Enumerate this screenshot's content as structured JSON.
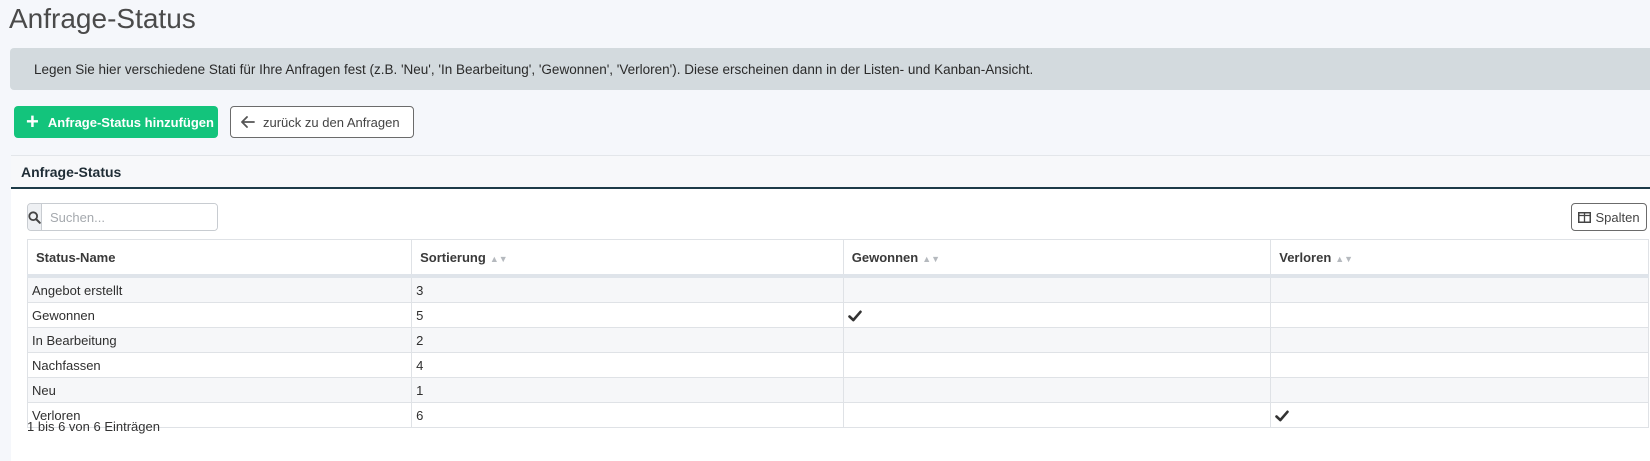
{
  "page": {
    "title": "Anfrage-Status"
  },
  "banner": {
    "text": "Legen Sie hier verschiedene Stati für Ihre Anfragen fest (z.B. 'Neu', 'In Bearbeitung', 'Gewonnen', 'Verloren'). Diese erscheinen dann in der Listen- und Kanban-Ansicht."
  },
  "actions": {
    "add_label": "Anfrage-Status hinzufügen",
    "back_label": "zurück zu den Anfragen"
  },
  "card": {
    "title": "Anfrage-Status",
    "search_placeholder": "Suchen...",
    "columns_button": "Spalten"
  },
  "table": {
    "headers": [
      "Status-Name",
      "Sortierung",
      "Gewonnen",
      "Verloren"
    ],
    "rows": [
      {
        "name": "Angebot erstellt",
        "sort": "3",
        "won": false,
        "lost": false
      },
      {
        "name": "Gewonnen",
        "sort": "5",
        "won": true,
        "lost": false
      },
      {
        "name": "In Bearbeitung",
        "sort": "2",
        "won": false,
        "lost": false
      },
      {
        "name": "Nachfassen",
        "sort": "4",
        "won": false,
        "lost": false
      },
      {
        "name": "Neu",
        "sort": "1",
        "won": false,
        "lost": false
      },
      {
        "name": "Verloren",
        "sort": "6",
        "won": false,
        "lost": true
      }
    ],
    "footer": "1 bis 6 von 6 Einträgen"
  },
  "colors": {
    "primary": "#13c47c",
    "header_rule": "#1d3b48",
    "banner_bg": "#d3dade"
  },
  "icons": {
    "add": "plus-icon",
    "back": "arrow-left-icon",
    "search": "search-icon",
    "columns": "columns-icon",
    "check": "check-icon",
    "sort": "sort-icon"
  }
}
